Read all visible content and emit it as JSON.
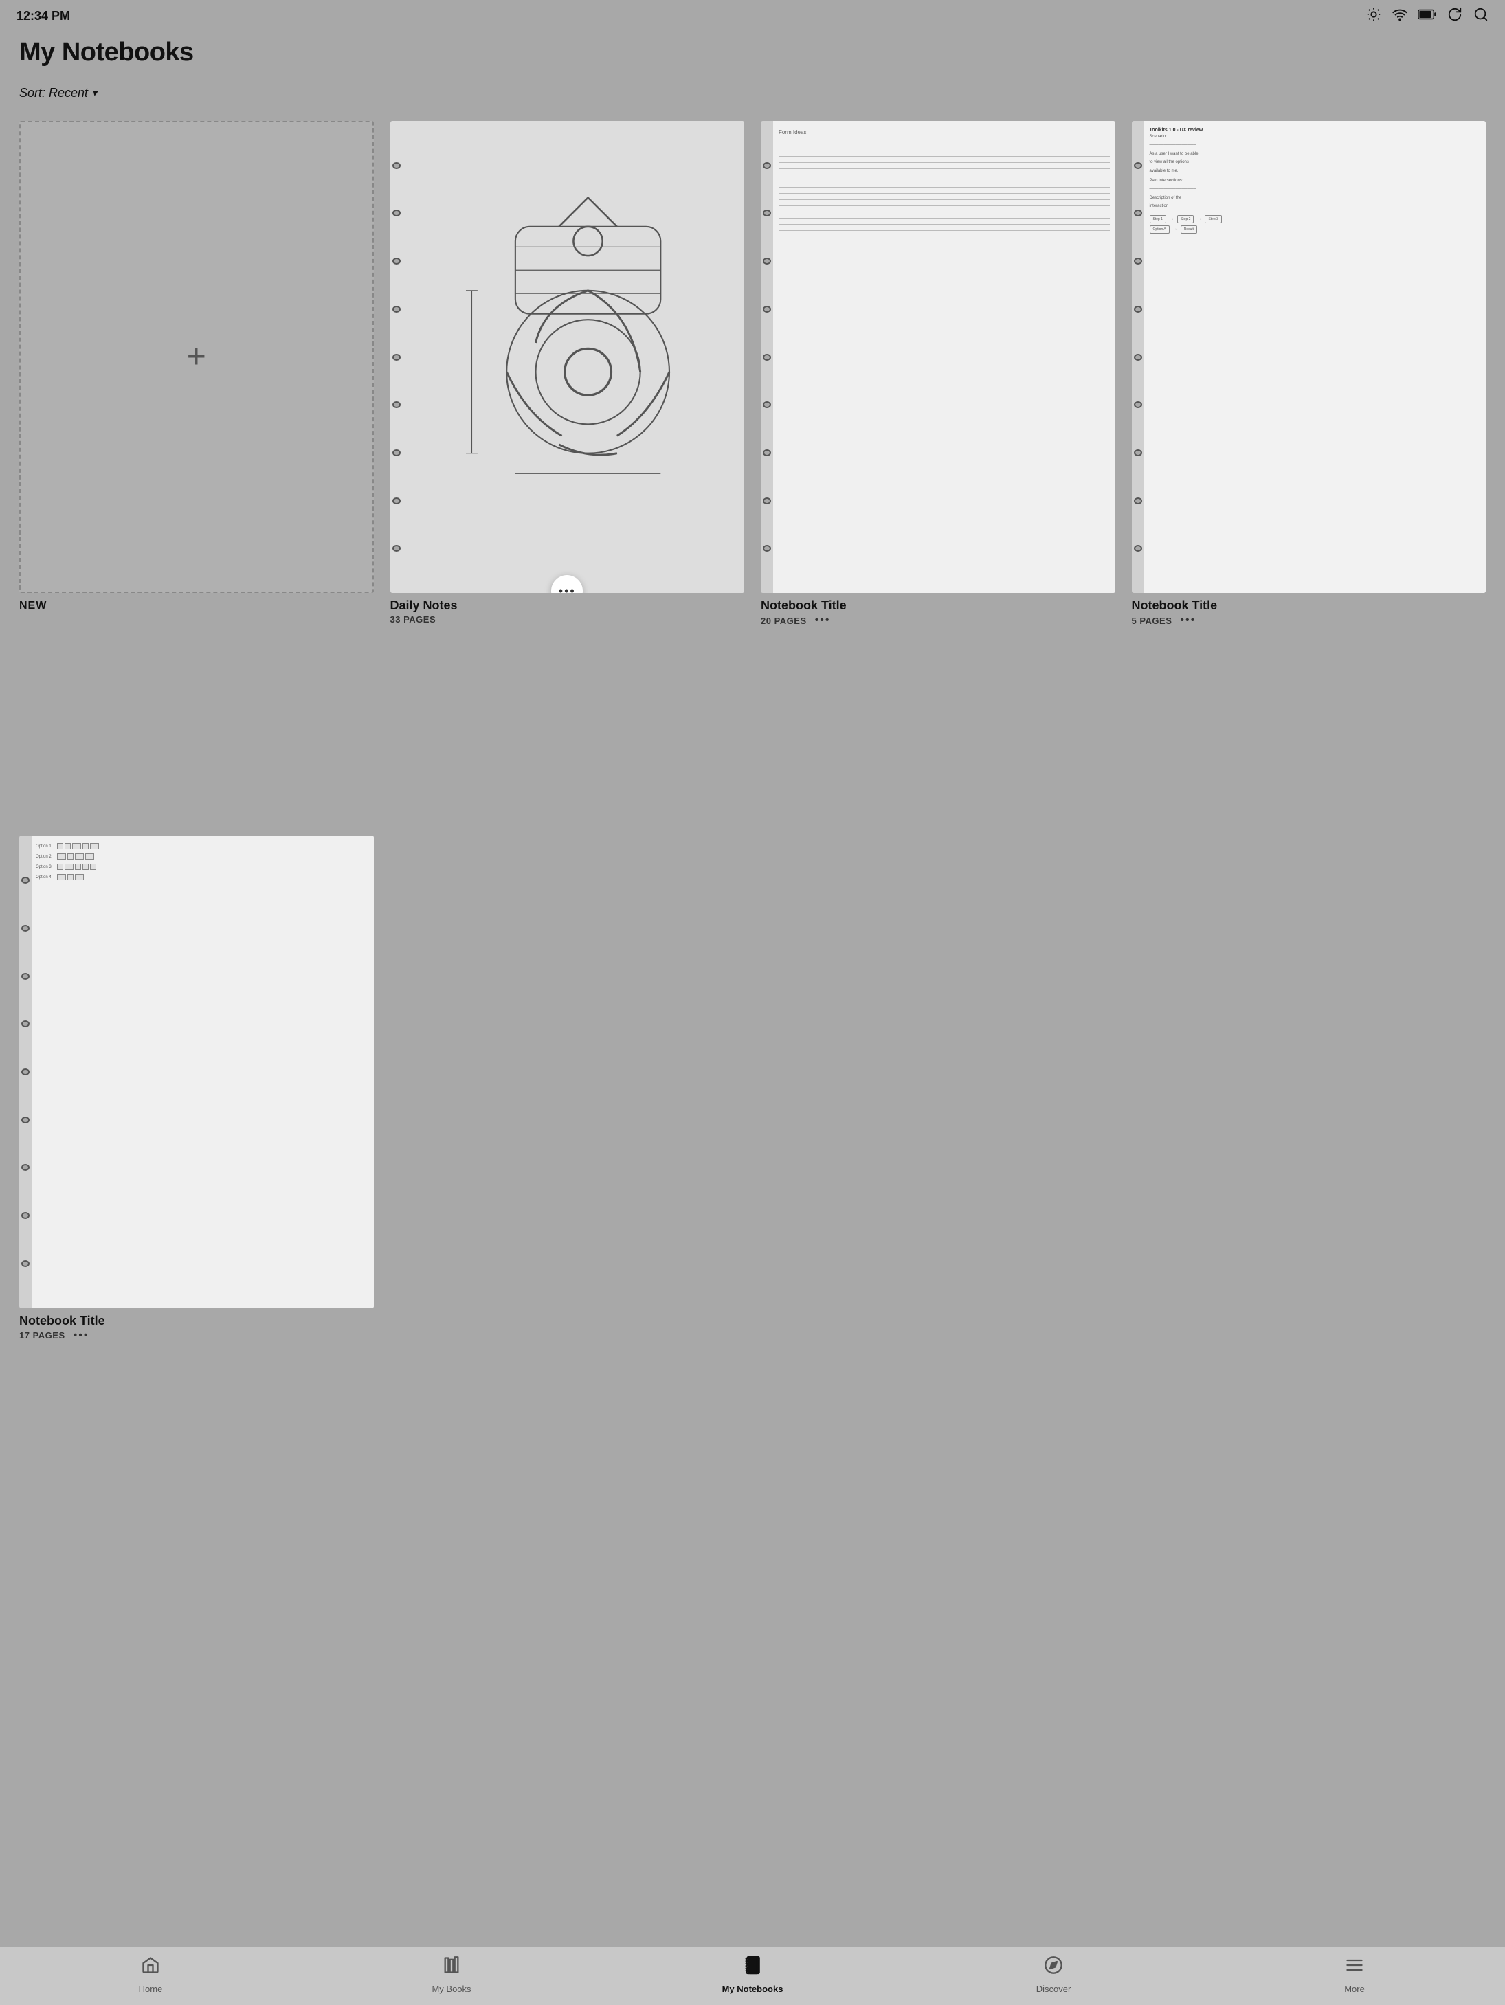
{
  "statusBar": {
    "time": "12:34 PM",
    "icons": [
      "brightness",
      "wifi",
      "battery",
      "sync",
      "search"
    ]
  },
  "header": {
    "title": "My Notebooks"
  },
  "sort": {
    "label": "Sort: Recent",
    "chevron": "▾"
  },
  "notebooks": [
    {
      "id": "new",
      "type": "new",
      "label": "NEW"
    },
    {
      "id": "daily-notes",
      "type": "regular",
      "name": "Daily Notes",
      "pages": "33 PAGES",
      "coverType": "daily",
      "hasFloatingMore": true
    },
    {
      "id": "notebook-2",
      "type": "regular",
      "name": "Notebook Title",
      "pages": "20 PAGES",
      "coverType": "lined"
    },
    {
      "id": "notebook-3",
      "type": "regular",
      "name": "Notebook Title",
      "pages": "5 PAGES",
      "coverType": "text"
    },
    {
      "id": "notebook-4",
      "type": "regular",
      "name": "Notebook Title",
      "pages": "17 PAGES",
      "coverType": "options"
    }
  ],
  "nav": {
    "items": [
      {
        "id": "home",
        "label": "Home",
        "active": false
      },
      {
        "id": "my-books",
        "label": "My Books",
        "active": false
      },
      {
        "id": "my-notebooks",
        "label": "My Notebooks",
        "active": true
      },
      {
        "id": "discover",
        "label": "Discover",
        "active": false
      },
      {
        "id": "more",
        "label": "More",
        "active": false
      }
    ]
  },
  "moreButtonLabel": "•••"
}
